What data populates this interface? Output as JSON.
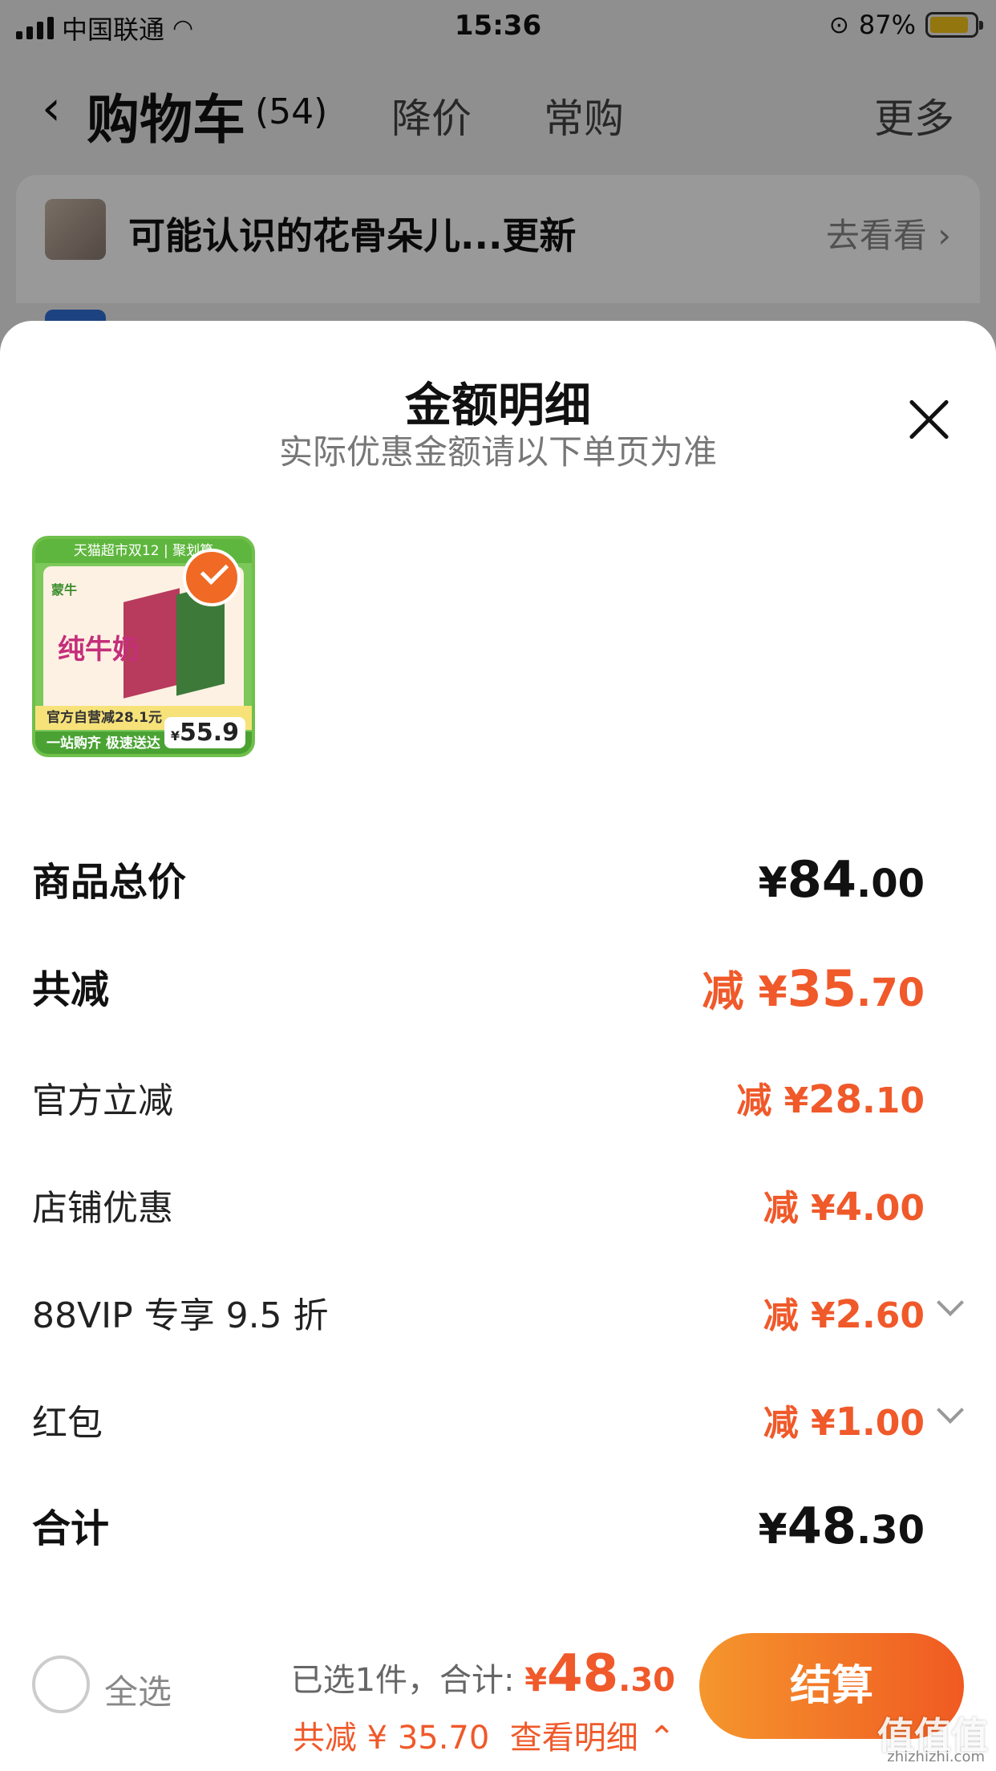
{
  "status_bar": {
    "carrier": "中国联通",
    "time": "15:36",
    "battery": "87%",
    "battery_level": 0.87
  },
  "nav": {
    "back_icon": "chevron-left-icon",
    "title": "购物车",
    "count": "(54)",
    "tab_price_drop": "降价",
    "tab_frequent": "常购",
    "more": "更多"
  },
  "notice": {
    "text": "可能认识的花骨朵儿...更新",
    "link": "去看看"
  },
  "sheet": {
    "title": "金额明细",
    "subtitle": "实际优惠金额请以下单页为准",
    "product": {
      "banner": "天猫超市双12 | 聚划算",
      "brand": "蒙牛",
      "name": "纯牛奶",
      "promo": "官方自营减28.1元",
      "promo2": "一站购齐 极速送达",
      "price_symbol": "¥",
      "price": "55.9",
      "selected": true
    },
    "rows": {
      "total_price": {
        "label": "商品总价",
        "yen": "¥",
        "int": "84",
        "dec": ".00"
      },
      "total_discount": {
        "label": "共减",
        "prefix": "减 ¥",
        "int": "35",
        "dec": ".70"
      },
      "official": {
        "label": "官方立减",
        "prefix": "减 ¥",
        "int": "28",
        "dec": ".10"
      },
      "shop": {
        "label": "店铺优惠",
        "prefix": "减 ¥",
        "int": "4",
        "dec": ".00"
      },
      "vip": {
        "label": "88VIP 专享 9.5 折",
        "prefix": "减 ¥",
        "int": "2",
        "dec": ".60"
      },
      "red_packet": {
        "label": "红包",
        "prefix": "减 ¥",
        "int": "1",
        "dec": ".00"
      },
      "sum": {
        "label": "合计",
        "yen": "¥",
        "int": "48",
        "dec": ".30"
      }
    }
  },
  "bottom": {
    "select_all": "全选",
    "selected_text": "已选1件，合计:",
    "yen": "¥",
    "total_int": "48",
    "total_dec": ".30",
    "discount_text": "共减 ¥ 35.70",
    "detail_link": "查看明细",
    "checkout": "结算",
    "watermark": "值值值",
    "watermark_sub": "zhizhizhi.com"
  },
  "colors": {
    "accent": "#f0592a",
    "checkout_gradient_start": "#f5962d",
    "checkout_gradient_end": "#f05a22"
  }
}
